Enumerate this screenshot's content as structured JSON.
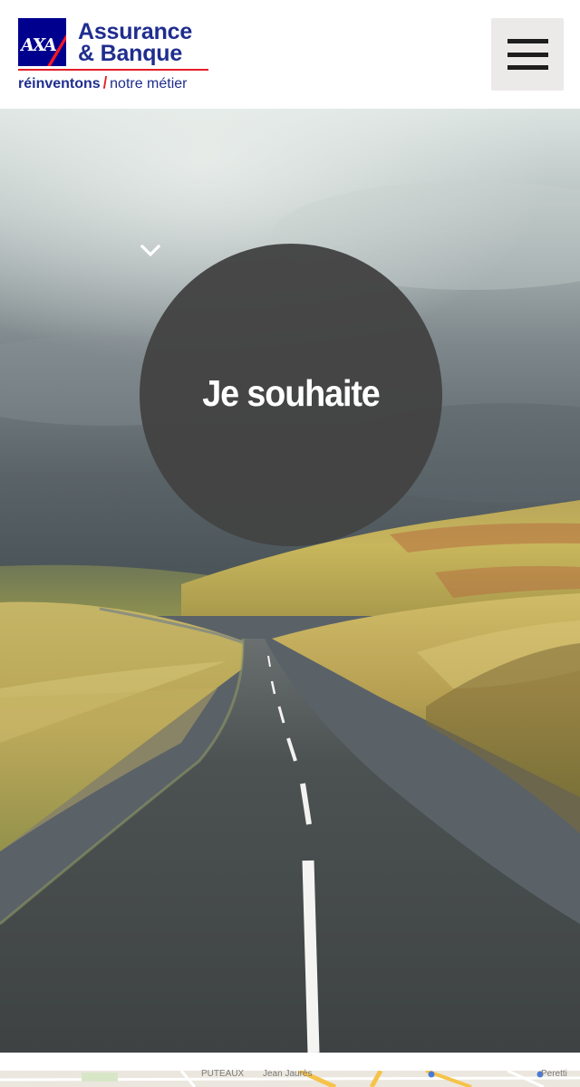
{
  "header": {
    "logo_mark": "AXA",
    "brand_line1": "Assurance",
    "brand_line2": "& Banque",
    "tagline_bold": "réinventons",
    "tagline_slash": "/",
    "tagline_rest": "notre métier",
    "menu_icon": "hamburger-menu-icon"
  },
  "hero": {
    "cta_label": "Je souhaite",
    "cta_icon": "chevron-down-icon"
  },
  "map": {
    "labels": [
      "PUTEAUX",
      "Jean Jaurès",
      "Peretti"
    ]
  },
  "colors": {
    "brand_blue": "#00008f",
    "brand_red": "#e41f26",
    "menu_bg": "#ece9e9",
    "circle_bg": "#434343"
  }
}
